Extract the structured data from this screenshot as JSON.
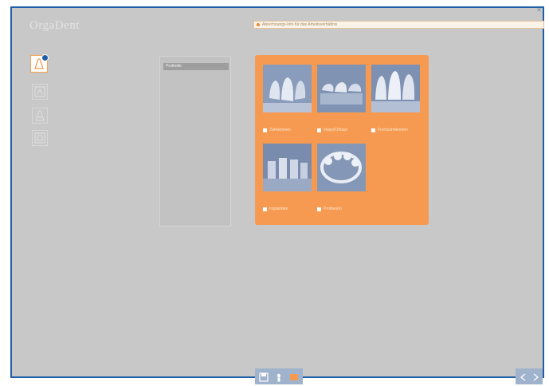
{
  "app": {
    "logo_text": "OrgaDent"
  },
  "status": {
    "message": "Abrechnungs-Info für das Arbeitsverhältnis"
  },
  "tools": [
    {
      "name": "crown-tool-icon",
      "active": true
    },
    {
      "name": "bridge-tool-icon",
      "active": false
    },
    {
      "name": "implant-tool-icon",
      "active": false
    },
    {
      "name": "model-tool-icon",
      "active": false
    }
  ],
  "list": {
    "items": [
      "Prothetik"
    ]
  },
  "gallery": {
    "items": [
      {
        "label": "Zahnkronen"
      },
      {
        "label": "Inlays/Onlays"
      },
      {
        "label": "Frontzahnkronen"
      },
      {
        "label": "Implantate"
      },
      {
        "label": "Prothesen"
      }
    ]
  },
  "taskbar": {
    "icons": [
      "save-icon",
      "person-icon",
      "tag-icon"
    ]
  },
  "nav": {
    "icons": [
      "prev-arrow-icon",
      "next-arrow-icon"
    ]
  },
  "colors": {
    "accent": "#f59a50",
    "frame": "#1f5fa8",
    "background": "#c8c8c8"
  }
}
